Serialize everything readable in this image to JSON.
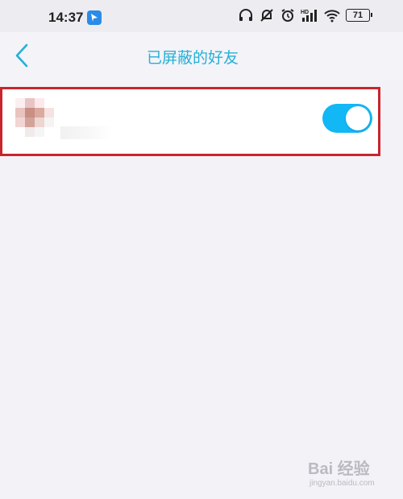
{
  "status_bar": {
    "time": "14:37",
    "battery": "71",
    "icons": [
      "app-icon",
      "headphones-icon",
      "mute-bell-icon",
      "alarm-icon",
      "signal-icon",
      "wifi-icon",
      "battery-icon"
    ]
  },
  "nav": {
    "back_icon": "chevron-left-icon",
    "title": "已屏蔽的好友"
  },
  "blocked_friends": [
    {
      "avatar": "blurred-avatar",
      "name": "",
      "blocked": true
    }
  ],
  "watermark": {
    "main": "Bai 经验",
    "sub": "jingyan.baidu.com"
  },
  "colors": {
    "accent": "#24b0d8",
    "toggle_on": "#12b7f5",
    "highlight_border": "#c8252d",
    "background": "#f2f2f7"
  }
}
